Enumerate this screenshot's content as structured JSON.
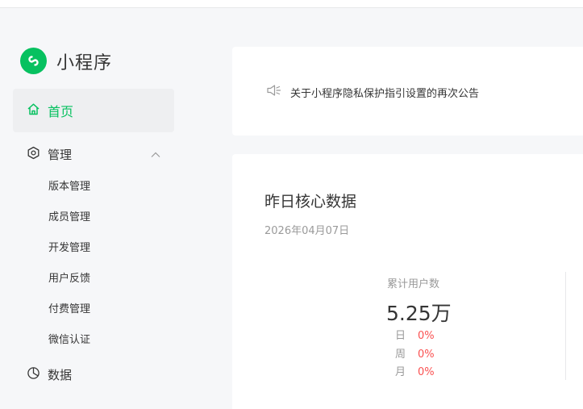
{
  "brand": {
    "name": "小程序",
    "color": "#07c160"
  },
  "sidebar": {
    "home": {
      "label": "首页",
      "icon": "home-icon"
    },
    "manage": {
      "label": "管理",
      "icon": "hexagon-settings-icon",
      "expanded": true,
      "items": [
        {
          "label": "版本管理"
        },
        {
          "label": "成员管理"
        },
        {
          "label": "开发管理"
        },
        {
          "label": "用户反馈"
        },
        {
          "label": "付费管理"
        },
        {
          "label": "微信认证"
        }
      ]
    },
    "data": {
      "label": "数据",
      "icon": "pie-chart-icon"
    }
  },
  "notice": {
    "icon": "speaker-icon",
    "text": "关于小程序隐私保护指引设置的再次公告"
  },
  "core_data": {
    "title": "昨日核心数据",
    "date": "2026年04月07日",
    "metric": {
      "label": "累计用户数",
      "value": "5.25万",
      "trends": [
        {
          "period": "日",
          "change": "0%"
        },
        {
          "period": "周",
          "change": "0%"
        },
        {
          "period": "月",
          "change": "0%"
        }
      ]
    }
  }
}
